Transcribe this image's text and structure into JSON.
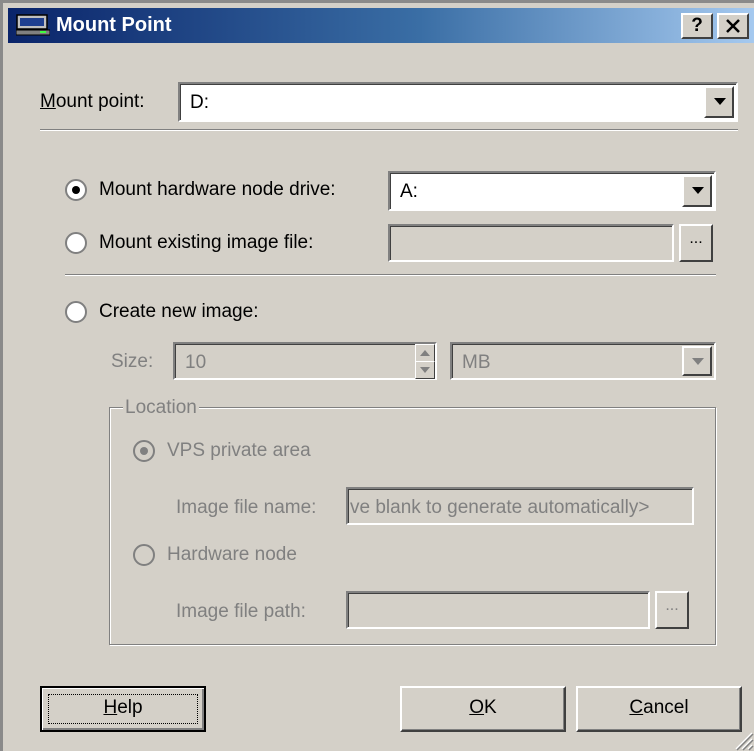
{
  "window": {
    "title": "Mount Point",
    "help_button": "?",
    "close_button": "✕"
  },
  "mount_point": {
    "label_accel": "M",
    "label_rest": "ount point:",
    "value": "D:"
  },
  "options": {
    "hardware_drive": {
      "label": "Mount hardware node drive:",
      "selected": true,
      "value": "A:"
    },
    "existing_image": {
      "label": "Mount existing image file:",
      "selected": false,
      "value": "",
      "browse": "..."
    },
    "create_new": {
      "label": "Create new image:",
      "selected": false
    }
  },
  "size": {
    "label": "Size:",
    "value": "10",
    "unit": "MB"
  },
  "location": {
    "legend": "Location",
    "vps_private_area": {
      "label": "VPS private area",
      "selected": true
    },
    "image_file_name_label": "Image file name:",
    "image_file_name_value": "ve blank to generate automatically>",
    "hardware_node": {
      "label": "Hardware node",
      "selected": false
    },
    "image_file_path_label": "Image file path:",
    "image_file_path_value": "",
    "browse": "..."
  },
  "buttons": {
    "help_accel": "H",
    "help_rest": "elp",
    "ok_accel": "O",
    "ok_rest": "K",
    "cancel_accel": "C",
    "cancel_rest": "ancel"
  },
  "colors": {
    "face": "#d4d0c8",
    "titlebar_start": "#0a246a",
    "titlebar_end": "#a6caf0",
    "disabled_text": "#808080"
  }
}
